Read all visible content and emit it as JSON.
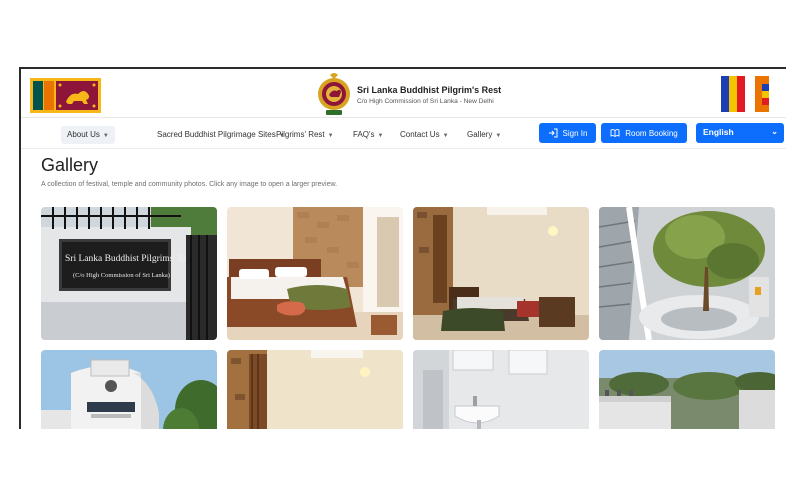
{
  "header": {
    "title": "Sri Lanka Buddhist Pilgrim's Rest",
    "subtitle": "C/o High Commission of Sri Lanka - New Delhi",
    "flag_left_icon": "sri-lanka-flag-icon",
    "emblem_icon": "sri-lanka-emblem-icon",
    "flag_right_icon": "buddhist-flag-icon"
  },
  "nav": {
    "items": [
      {
        "label": "About Us",
        "active": true
      },
      {
        "label": "Sacred Buddhist Pilgrimage Sites"
      },
      {
        "label": "Pilgrims' Rest"
      },
      {
        "label": "FAQ's"
      },
      {
        "label": "Contact Us"
      },
      {
        "label": "Gallery"
      }
    ],
    "sign_in": "Sign In",
    "room_booking": "Room Booking",
    "language": "English"
  },
  "page": {
    "title": "Gallery",
    "description": "A collection of festival, temple and community photos. Click any image to open a larger preview.",
    "sign_text_1": "Sri Lanka Buddhist Pilgrims' Rest",
    "sign_text_2": "(C/o High Commission of Sri Lanka)"
  },
  "gallery": {
    "photos": [
      {
        "subject": "entrance-sign-photo"
      },
      {
        "subject": "bedroom-double-bed-photo"
      },
      {
        "subject": "bedroom-twin-photo"
      },
      {
        "subject": "courtyard-tree-photo"
      },
      {
        "subject": "building-exterior-photo"
      },
      {
        "subject": "room-curtain-photo"
      },
      {
        "subject": "bathroom-sink-photo"
      },
      {
        "subject": "rooftop-view-photo"
      }
    ]
  },
  "colors": {
    "accent": "#0d6efd",
    "flag_maroon": "#8d153a",
    "flag_gold": "#f7b718",
    "flag_green": "#00534e",
    "flag_orange": "#eb7400"
  }
}
